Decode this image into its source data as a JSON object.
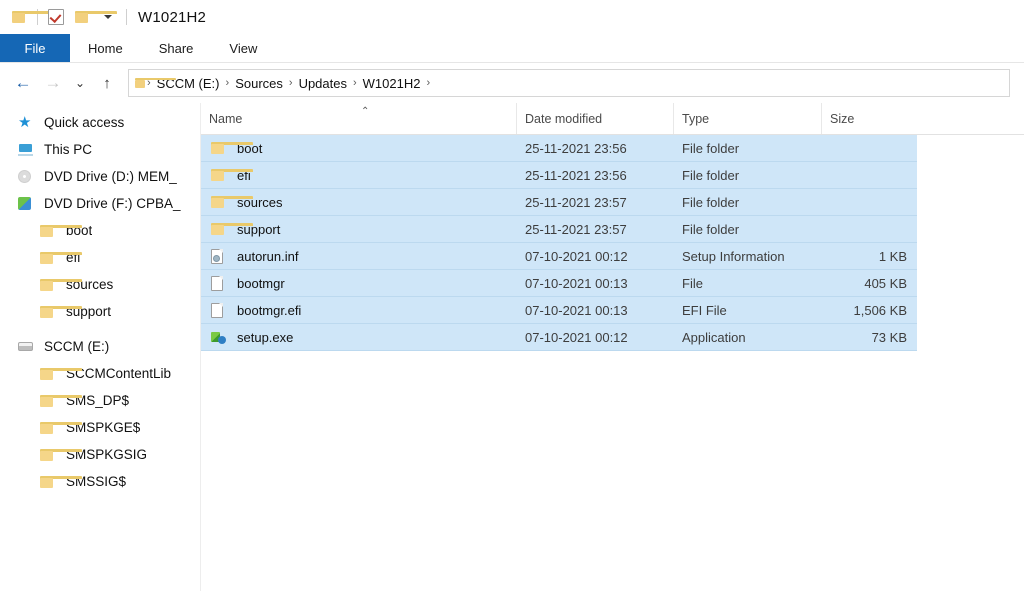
{
  "window": {
    "title": "W1021H2",
    "quick_access_toolbar": [
      {
        "name": "folder-icon",
        "label": "Folder"
      },
      {
        "name": "properties-icon",
        "label": "Properties"
      },
      {
        "name": "new-folder-icon",
        "label": "New folder"
      },
      {
        "name": "chevron-down-icon",
        "label": "Customize Quick Access Toolbar"
      }
    ]
  },
  "ribbon": {
    "tabs": [
      {
        "label": "File",
        "active": true
      },
      {
        "label": "Home",
        "active": false
      },
      {
        "label": "Share",
        "active": false
      },
      {
        "label": "View",
        "active": false
      }
    ]
  },
  "address_bar": {
    "back_label": "←",
    "forward_label": "→",
    "recent_label": "⌄",
    "up_label": "↑",
    "breadcrumbs": [
      "SCCM (E:)",
      "Sources",
      "Updates",
      "W1021H2"
    ],
    "separator": "›"
  },
  "sidebar": {
    "items": [
      {
        "label": "Quick access",
        "icon": "star-icon",
        "indent": false
      },
      {
        "label": "This PC",
        "icon": "this-pc-icon",
        "indent": false
      },
      {
        "label": "DVD Drive (D:) MEM_",
        "icon": "dvd-drive-icon",
        "indent": false
      },
      {
        "label": "DVD Drive (F:) CPBA_",
        "icon": "dvd-drive-green-icon",
        "indent": false
      },
      {
        "label": "boot",
        "icon": "folder-icon",
        "indent": true
      },
      {
        "label": "efi",
        "icon": "folder-icon",
        "indent": true
      },
      {
        "label": "sources",
        "icon": "folder-icon",
        "indent": true
      },
      {
        "label": "support",
        "icon": "folder-icon",
        "indent": true
      },
      {
        "label": "SCCM (E:)",
        "icon": "hard-drive-icon",
        "indent": false
      },
      {
        "label": "SCCMContentLib",
        "icon": "folder-icon",
        "indent": true
      },
      {
        "label": "SMS_DP$",
        "icon": "folder-icon",
        "indent": true
      },
      {
        "label": "SMSPKGE$",
        "icon": "folder-icon",
        "indent": true
      },
      {
        "label": "SMSPKGSIG",
        "icon": "folder-icon",
        "indent": true
      },
      {
        "label": "SMSSIG$",
        "icon": "folder-icon",
        "indent": true
      }
    ]
  },
  "file_list": {
    "columns": [
      {
        "label": "Name",
        "sorted": "asc",
        "sort_caret": "⌃"
      },
      {
        "label": "Date modified",
        "sorted": ""
      },
      {
        "label": "Type",
        "sorted": ""
      },
      {
        "label": "Size",
        "sorted": ""
      }
    ],
    "rows": [
      {
        "name": "boot",
        "date": "25-11-2021 23:56",
        "type": "File folder",
        "size": "",
        "icon": "folder-icon",
        "selected": true
      },
      {
        "name": "efi",
        "date": "25-11-2021 23:56",
        "type": "File folder",
        "size": "",
        "icon": "folder-icon",
        "selected": true
      },
      {
        "name": "sources",
        "date": "25-11-2021 23:57",
        "type": "File folder",
        "size": "",
        "icon": "folder-icon",
        "selected": true
      },
      {
        "name": "support",
        "date": "25-11-2021 23:57",
        "type": "File folder",
        "size": "",
        "icon": "folder-icon",
        "selected": true
      },
      {
        "name": "autorun.inf",
        "date": "07-10-2021 00:12",
        "type": "Setup Information",
        "size": "1 KB",
        "icon": "setup-information-icon",
        "selected": true
      },
      {
        "name": "bootmgr",
        "date": "07-10-2021 00:13",
        "type": "File",
        "size": "405 KB",
        "icon": "generic-file-icon",
        "selected": true
      },
      {
        "name": "bootmgr.efi",
        "date": "07-10-2021 00:13",
        "type": "EFI File",
        "size": "1,506 KB",
        "icon": "generic-file-icon",
        "selected": true
      },
      {
        "name": "setup.exe",
        "date": "07-10-2021 00:12",
        "type": "Application",
        "size": "73 KB",
        "icon": "application-icon",
        "selected": true
      }
    ]
  },
  "colors": {
    "file_tab_blue": "#1567b5",
    "selection_blue": "#cfe6f8",
    "folder_yellow": "#f2d07e"
  }
}
